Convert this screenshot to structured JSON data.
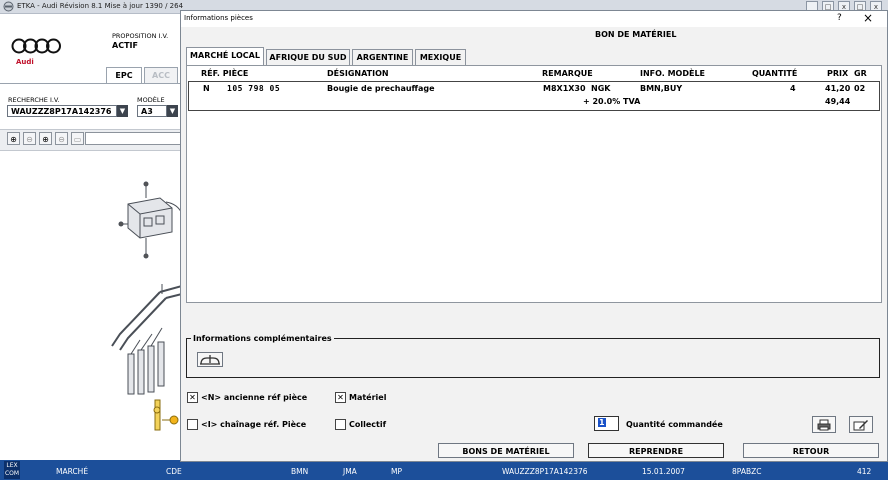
{
  "window": {
    "title": "ETKA - Audi Révision 8.1 Mise à jour 1390 / 264",
    "minimize": "_",
    "maximize": "□",
    "close": "x"
  },
  "left": {
    "brand": "Audi",
    "proposition_label": "PROPOSITION I.V.",
    "proposition_value": "ACTIF",
    "tabs": [
      "EPC",
      "ACC"
    ],
    "vin_label": "RECHERCHE I.V.",
    "vin_value": "WAUZZZ8P17A142376",
    "model_label": "MODÈLE",
    "model_value": "A3",
    "tools": [
      "zoom-in",
      "zoom-out",
      "zoom-fit",
      "zoom-window",
      "view"
    ]
  },
  "dialog": {
    "title": "Informations pièces",
    "help": "?",
    "close": "×",
    "header": "BON DE MATÉRIEL",
    "tabs": [
      "MARCHÉ LOCAL",
      "AFRIQUE DU SUD",
      "ARGENTINE",
      "MEXIQUE"
    ],
    "columns": {
      "ref": "RÉF. PIÈCE",
      "designation": "DÉSIGNATION",
      "remarque": "REMARQUE",
      "info": "INFO. MODÈLE",
      "qty": "QUANTITÉ",
      "price": "PRIX",
      "gr": "GR"
    },
    "row": {
      "flag": "N",
      "ref": "105 798 05",
      "designation": "Bougie de prechauffage",
      "remarque1": "M8X1X30",
      "remarque2": "NGK",
      "info": "BMN,BUY",
      "qty": "4",
      "price": "41,20",
      "gr": "02",
      "tva_label": "+ 20.0% TVA",
      "price_tva": "49,44"
    },
    "compl_title": "Informations complémentaires",
    "opt_ancienne": "<N> ancienne réf pièce",
    "opt_materiel": "Matériel",
    "opt_chainage": "<I> chaînage réf. Pièce",
    "opt_collectif": "Collectif",
    "qty_value": "1",
    "qty_label": "Quantité commandée",
    "btn_bons": "BONS DE MATÉRIEL",
    "btn_reprendre": "REPRENDRE",
    "btn_retour": "RETOUR"
  },
  "status": {
    "logo": "LEX COM",
    "marche": "MARCHÉ",
    "cde": "CDE",
    "bmn": "BMN",
    "jma": "JMA",
    "mp": "MP",
    "vin": "WAUZZZ8P17A142376",
    "date": "15.01.2007",
    "code": "8PABZC",
    "num": "412"
  },
  "colors": {
    "status_bg": "#1c4f9a",
    "dialog_bg": "#f2f2f2",
    "link_blue": "#1a52c8"
  }
}
